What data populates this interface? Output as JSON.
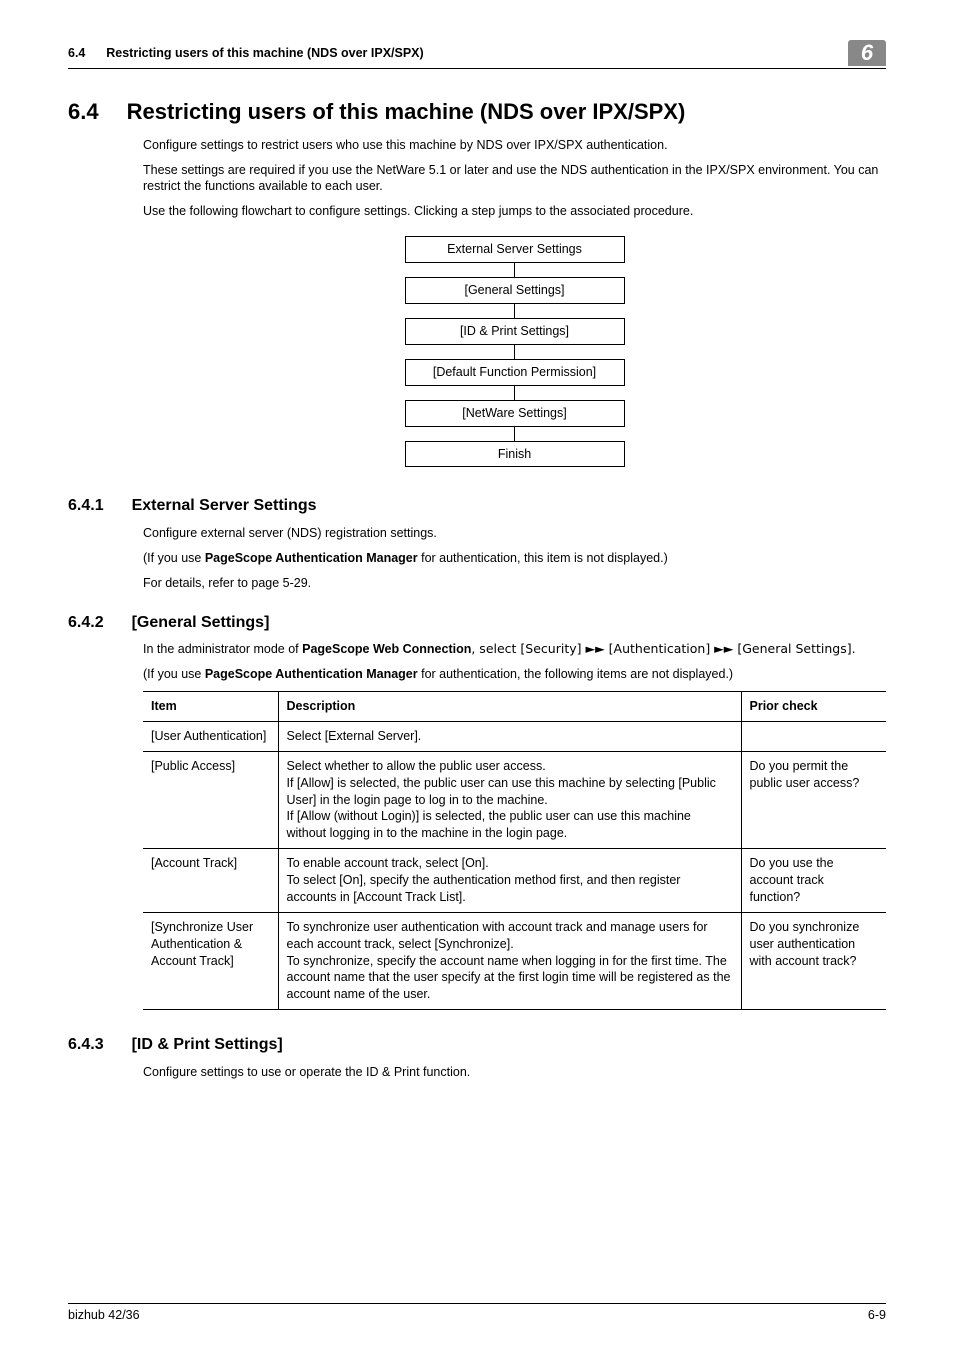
{
  "header": {
    "section_number": "6.4",
    "section_title": "Restricting users of this machine (NDS over IPX/SPX)",
    "badge": "6"
  },
  "main_title": {
    "num": "6.4",
    "text": "Restricting users of this machine (NDS over IPX/SPX)"
  },
  "intro": {
    "p1": "Configure settings to restrict users who use this machine by NDS over IPX/SPX authentication.",
    "p2": "These settings are required if you use the NetWare 5.1 or later and use the NDS authentication in the IPX/SPX environment. You can restrict the functions available to each user.",
    "p3": "Use the following flowchart to configure settings. Clicking a step jumps to the associated procedure."
  },
  "flow": {
    "b1": "External Server Settings",
    "b2": "[General Settings]",
    "b3": "[ID & Print Settings]",
    "b4": "[Default Function Permission]",
    "b5": "[NetWare Settings]",
    "b6": "Finish"
  },
  "sec641": {
    "num": "6.4.1",
    "title": "External Server Settings",
    "p1": "Configure external server (NDS) registration settings.",
    "p2_pre": "(If you use ",
    "p2_bold": "PageScope Authentication Manager",
    "p2_post": " for authentication, this item is not displayed.)",
    "p3": "For details, refer to page 5-29."
  },
  "sec642": {
    "num": "6.4.2",
    "title": "[General Settings]",
    "p1_pre": "In the administrator mode of ",
    "p1_bold": "PageScope Web Connection",
    "p1_post": ", select [Security] ►► [Authentication] ►► [General Settings].",
    "p2_pre": "(If you use ",
    "p2_bold": "PageScope Authentication Manager",
    "p2_post": " for authentication, the following items are not displayed.)",
    "table_headers": {
      "c1": "Item",
      "c2": "Description",
      "c3": "Prior check"
    },
    "rows": [
      {
        "item": "[User Authentication]",
        "desc": "Select [External Server].",
        "prior": ""
      },
      {
        "item": "[Public Access]",
        "desc": "Select whether to allow the public user access.\nIf [Allow] is selected, the public user can use this machine by selecting [Public User] in the login page to log in to the machine.\nIf [Allow (without Login)] is selected, the public user can use this machine without logging in to the machine in the login page.",
        "prior": "Do you permit the public user access?"
      },
      {
        "item": "[Account Track]",
        "desc": "To enable account track, select [On].\nTo select [On], specify the authentication method first, and then register accounts in [Account Track List].",
        "prior": "Do you use the account track function?"
      },
      {
        "item": "[Synchronize User Authentication & Account Track]",
        "desc": "To synchronize user authentication with account track and manage users for each account track, select [Synchronize].\nTo synchronize, specify the account name when logging in for the first time. The account name that the user specify at the first login time will be registered as the account name of the user.",
        "prior": "Do you synchronize user authentication with account track?"
      }
    ]
  },
  "sec643": {
    "num": "6.4.3",
    "title": "[ID & Print Settings]",
    "p1": "Configure settings to use or operate the ID & Print function."
  },
  "footer": {
    "left": "bizhub 42/36",
    "right": "6-9"
  }
}
